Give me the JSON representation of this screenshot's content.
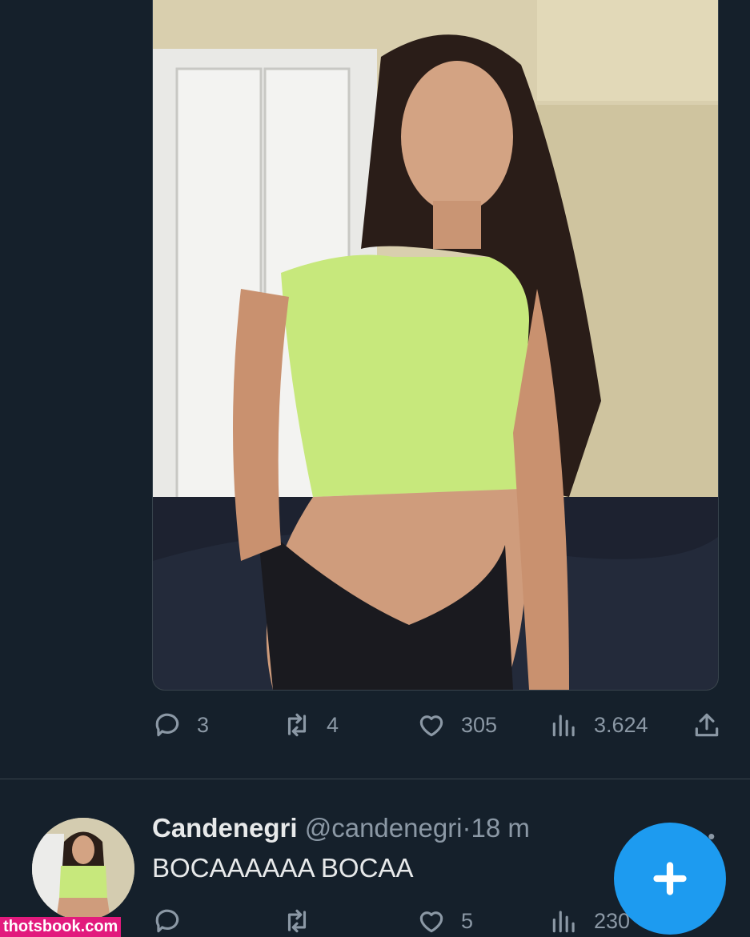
{
  "tweet_1": {
    "actions": {
      "reply_count": "3",
      "retweet_count": "4",
      "like_count": "305",
      "views_count": "3.624"
    }
  },
  "tweet_2": {
    "display_name": "Candenegri",
    "handle": "@candenegri",
    "separator": "·",
    "time": "18 m",
    "text": "BOCAAAAAA BOCAA",
    "actions": {
      "reply_count": "",
      "retweet_count": "",
      "like_count": "5",
      "views_count": "230"
    }
  },
  "fab": {
    "icon": "plus-icon",
    "color": "#1d9bf0"
  },
  "watermark": {
    "text": "thotsbook.com",
    "color": "#e21a7d"
  },
  "theme": {
    "background": "#15202b",
    "secondary_text": "#8b98a5"
  }
}
